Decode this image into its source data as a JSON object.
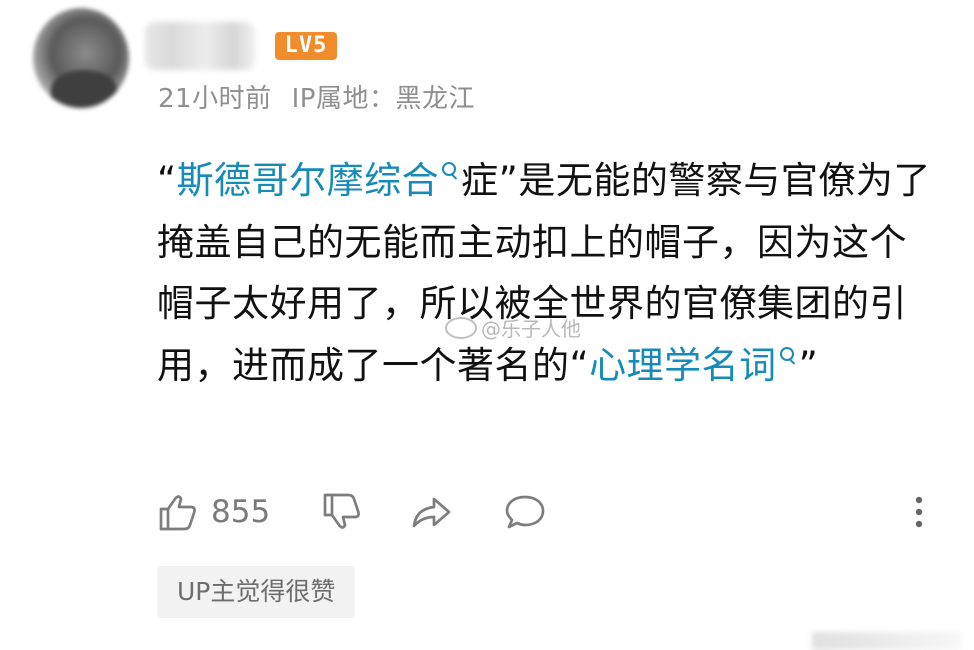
{
  "header": {
    "level_badge": "LV5",
    "time": "21小时前",
    "ip_location": "IP属地：黑龙江"
  },
  "comment": {
    "part1": "“",
    "keyword1": "斯德哥尔摩综合",
    "part2": "症”是无能的警察与官僚为了掩盖自己的无能而主动扣上的帽子，因为这个帽子太好用了，所以被全世界的官僚集团的引用，进而成了一个著名的“",
    "keyword2": "心理学名词",
    "part3": "”"
  },
  "watermark": {
    "text": "@乐子人他"
  },
  "actions": {
    "like_count": "855",
    "icons": [
      "thumbs-up-icon",
      "thumbs-down-icon",
      "share-icon",
      "comment-icon",
      "more-icon"
    ]
  },
  "reply_tag": {
    "label": "UP主觉得很赞"
  },
  "colors": {
    "keyword": "#178bb7",
    "badge": "#f08c2b",
    "meta": "#8f8f8f"
  }
}
